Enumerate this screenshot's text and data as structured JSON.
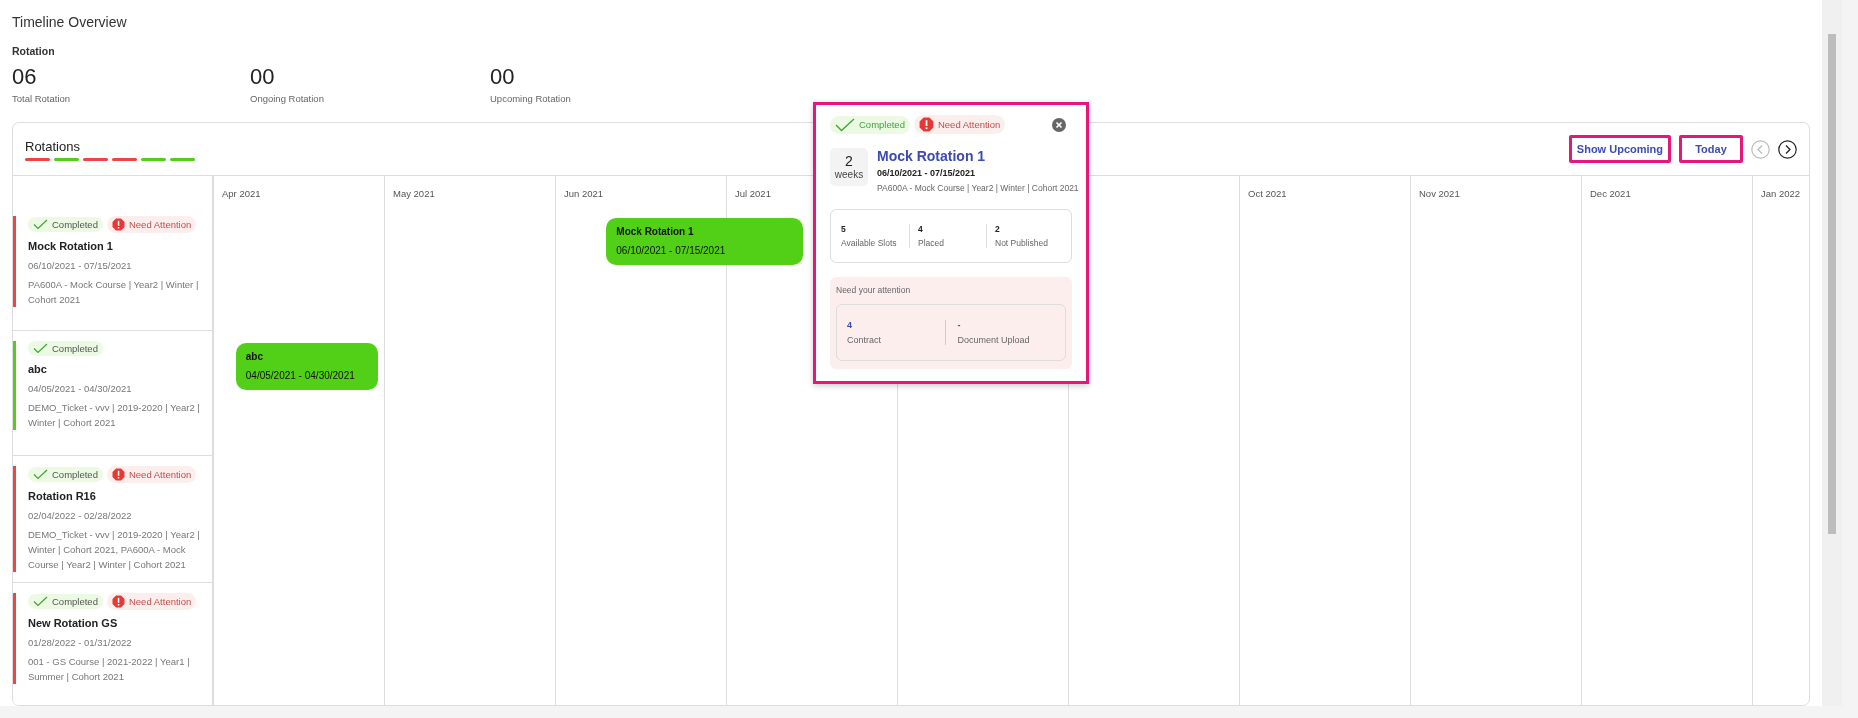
{
  "page_title": "Timeline Overview",
  "summary": {
    "heading": "Rotation",
    "stats": [
      {
        "value": "06",
        "label": "Total Rotation"
      },
      {
        "value": "00",
        "label": "Ongoing Rotation"
      },
      {
        "value": "00",
        "label": "Upcoming Rotation"
      }
    ]
  },
  "rotations_card": {
    "title": "Rotations",
    "legend": [
      {
        "color": "#ef4444"
      },
      {
        "color": "#52d017"
      },
      {
        "color": "#ef4444"
      },
      {
        "color": "#ef4444"
      },
      {
        "color": "#52d017"
      },
      {
        "color": "#52d017"
      }
    ],
    "actions": [
      {
        "label": "Show Upcoming"
      },
      {
        "label": "Today"
      }
    ],
    "nav": [
      {
        "kind": "prev",
        "disabled": true
      },
      {
        "kind": "next",
        "disabled": false
      }
    ],
    "months": [
      {
        "label": "Apr 2021"
      },
      {
        "label": "May 2021"
      },
      {
        "label": "Jun 2021"
      },
      {
        "label": "Jul 2021"
      },
      {
        "label": "Oct 2021"
      },
      {
        "label": "Nov 2021"
      },
      {
        "label": "Dec 2021"
      },
      {
        "label": "Jan 2022"
      }
    ],
    "rotations": [
      {
        "color": "#ef4444",
        "badges": [
          {
            "kind": "completed",
            "label": "Completed"
          },
          {
            "kind": "attention",
            "label": "Need Attention"
          }
        ],
        "name": "Mock Rotation 1",
        "dates": "06/10/2021 - 07/15/2021",
        "details": "PA600A - Mock Course | Year2 | Winter | Cohort 2021",
        "bar": {
          "title": "Mock Rotation 1",
          "dates": "06/10/2021 - 07/15/2021"
        }
      },
      {
        "color": "#52d017",
        "badges": [
          {
            "kind": "completed",
            "label": "Completed"
          }
        ],
        "name": "abc",
        "dates": "04/05/2021 - 04/30/2021",
        "details": "DEMO_Ticket - vvv | 2019-2020 | Year2 | Winter | Cohort 2021",
        "bar": {
          "title": "abc",
          "dates": "04/05/2021 - 04/30/2021"
        }
      },
      {
        "color": "#ef4444",
        "badges": [
          {
            "kind": "completed",
            "label": "Completed"
          },
          {
            "kind": "attention",
            "label": "Need Attention"
          }
        ],
        "name": "Rotation R16",
        "dates": "02/04/2022 - 02/28/2022",
        "details": "DEMO_Ticket - vvv | 2019-2020 | Year2 | Winter | Cohort 2021, PA600A - Mock Course | Year2 | Winter | Cohort 2021"
      },
      {
        "color": "#ef4444",
        "badges": [
          {
            "kind": "completed",
            "label": "Completed"
          },
          {
            "kind": "attention",
            "label": "Need Attention"
          }
        ],
        "name": "New Rotation GS",
        "dates": "01/28/2022 - 01/31/2022",
        "details": "001 - GS Course | 2021-2022 | Year1 | Summer | Cohort 2021"
      }
    ]
  },
  "popup": {
    "badges": [
      {
        "kind": "completed",
        "label": "Completed"
      },
      {
        "kind": "attention",
        "label": "Need Attention"
      }
    ],
    "duration_value": "2",
    "duration_unit": "weeks",
    "title": "Mock Rotation 1",
    "dates": "06/10/2021 - 07/15/2021",
    "details": "PA600A - Mock Course | Year2 | Winter | Cohort 2021",
    "slots": [
      {
        "value": "5",
        "label": "Available Slots"
      },
      {
        "value": "4",
        "label": "Placed"
      },
      {
        "value": "2",
        "label": "Not Published"
      }
    ],
    "attention": {
      "heading": "Need your attention",
      "items": [
        {
          "value": "4",
          "label": "Contract",
          "link": true
        },
        {
          "value": "-",
          "label": "Document Upload",
          "link": false
        }
      ]
    }
  }
}
